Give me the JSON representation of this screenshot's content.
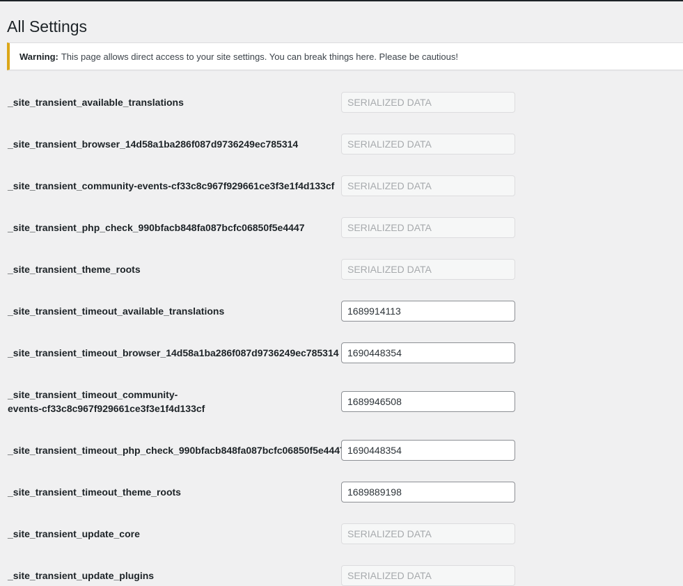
{
  "page": {
    "title": "All Settings"
  },
  "notice": {
    "strong": "Warning:",
    "text": "This page allows direct access to your site settings. You can break things here. Please be cautious!"
  },
  "colors": {
    "notice_accent": "#dba617",
    "background": "#f0f0f1"
  },
  "options": [
    {
      "name": "_site_transient_available_translations",
      "value": "SERIALIZED DATA",
      "serialized": true
    },
    {
      "name": "_site_transient_browser_14d58a1ba286f087d9736249ec785314",
      "value": "SERIALIZED DATA",
      "serialized": true
    },
    {
      "name": "_site_transient_community-events-cf33c8c967f929661ce3f3e1f4d133cf",
      "value": "SERIALIZED DATA",
      "serialized": true
    },
    {
      "name": "_site_transient_php_check_990bfacb848fa087bcfc06850f5e4447",
      "value": "SERIALIZED DATA",
      "serialized": true
    },
    {
      "name": "_site_transient_theme_roots",
      "value": "SERIALIZED DATA",
      "serialized": true
    },
    {
      "name": "_site_transient_timeout_available_translations",
      "value": "1689914113",
      "serialized": false
    },
    {
      "name": "_site_transient_timeout_browser_14d58a1ba286f087d9736249ec785314",
      "value": "1690448354",
      "serialized": false
    },
    {
      "name": "_site_transient_timeout_community-events-cf33c8c967f929661ce3f3e1f4d133cf",
      "value": "1689946508",
      "serialized": false
    },
    {
      "name": "_site_transient_timeout_php_check_990bfacb848fa087bcfc06850f5e4447",
      "value": "1690448354",
      "serialized": false
    },
    {
      "name": "_site_transient_timeout_theme_roots",
      "value": "1689889198",
      "serialized": false
    },
    {
      "name": "_site_transient_update_core",
      "value": "SERIALIZED DATA",
      "serialized": true
    },
    {
      "name": "_site_transient_update_plugins",
      "value": "SERIALIZED DATA",
      "serialized": true
    }
  ]
}
